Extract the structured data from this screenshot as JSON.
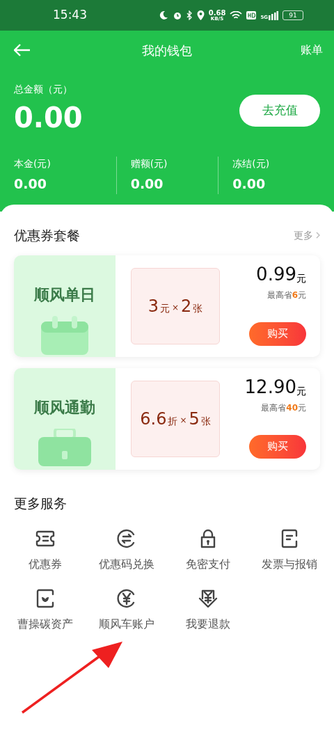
{
  "status_bar": {
    "time": "15:43",
    "speed": "0.68",
    "speed_unit": "KB/S",
    "network": "5G",
    "battery": "91"
  },
  "nav": {
    "title": "我的钱包",
    "action": "账单"
  },
  "balance": {
    "label": "总金额（元）",
    "amount": "0.00",
    "button": "去充值",
    "parts": [
      {
        "label": "本金(元)",
        "value": "0.00"
      },
      {
        "label": "赠额(元)",
        "value": "0.00"
      },
      {
        "label": "冻结(元)",
        "value": "0.00"
      }
    ]
  },
  "packages": {
    "title": "优惠券套餐",
    "more": "更多",
    "items": [
      {
        "kind": "calendar",
        "name": "顺风单日",
        "amount": "3",
        "amount_unit": "元",
        "times": "×",
        "count": "2",
        "count_unit": "张",
        "price": "0.99",
        "price_unit": "元",
        "save_prefix": "最高省",
        "save_amount": "6",
        "save_unit": "元",
        "button": "购买"
      },
      {
        "kind": "briefcase",
        "name": "顺风通勤",
        "amount": "6.6",
        "amount_unit": "折",
        "times": "×",
        "count": "5",
        "count_unit": "张",
        "price": "12.90",
        "price_unit": "元",
        "save_prefix": "最高省",
        "save_amount": "40",
        "save_unit": "元",
        "button": "购买"
      }
    ]
  },
  "services": {
    "title": "更多服务",
    "items": [
      {
        "kind": "ticket",
        "label": "优惠券"
      },
      {
        "kind": "exchange",
        "label": "优惠码兑换"
      },
      {
        "kind": "lock",
        "label": "免密支付"
      },
      {
        "kind": "invoice",
        "label": "发票与报销"
      },
      {
        "kind": "leaf",
        "label": "曹操碳资产"
      },
      {
        "kind": "yen",
        "label": "顺风车账户"
      },
      {
        "kind": "refund",
        "label": "我要退款"
      }
    ]
  }
}
